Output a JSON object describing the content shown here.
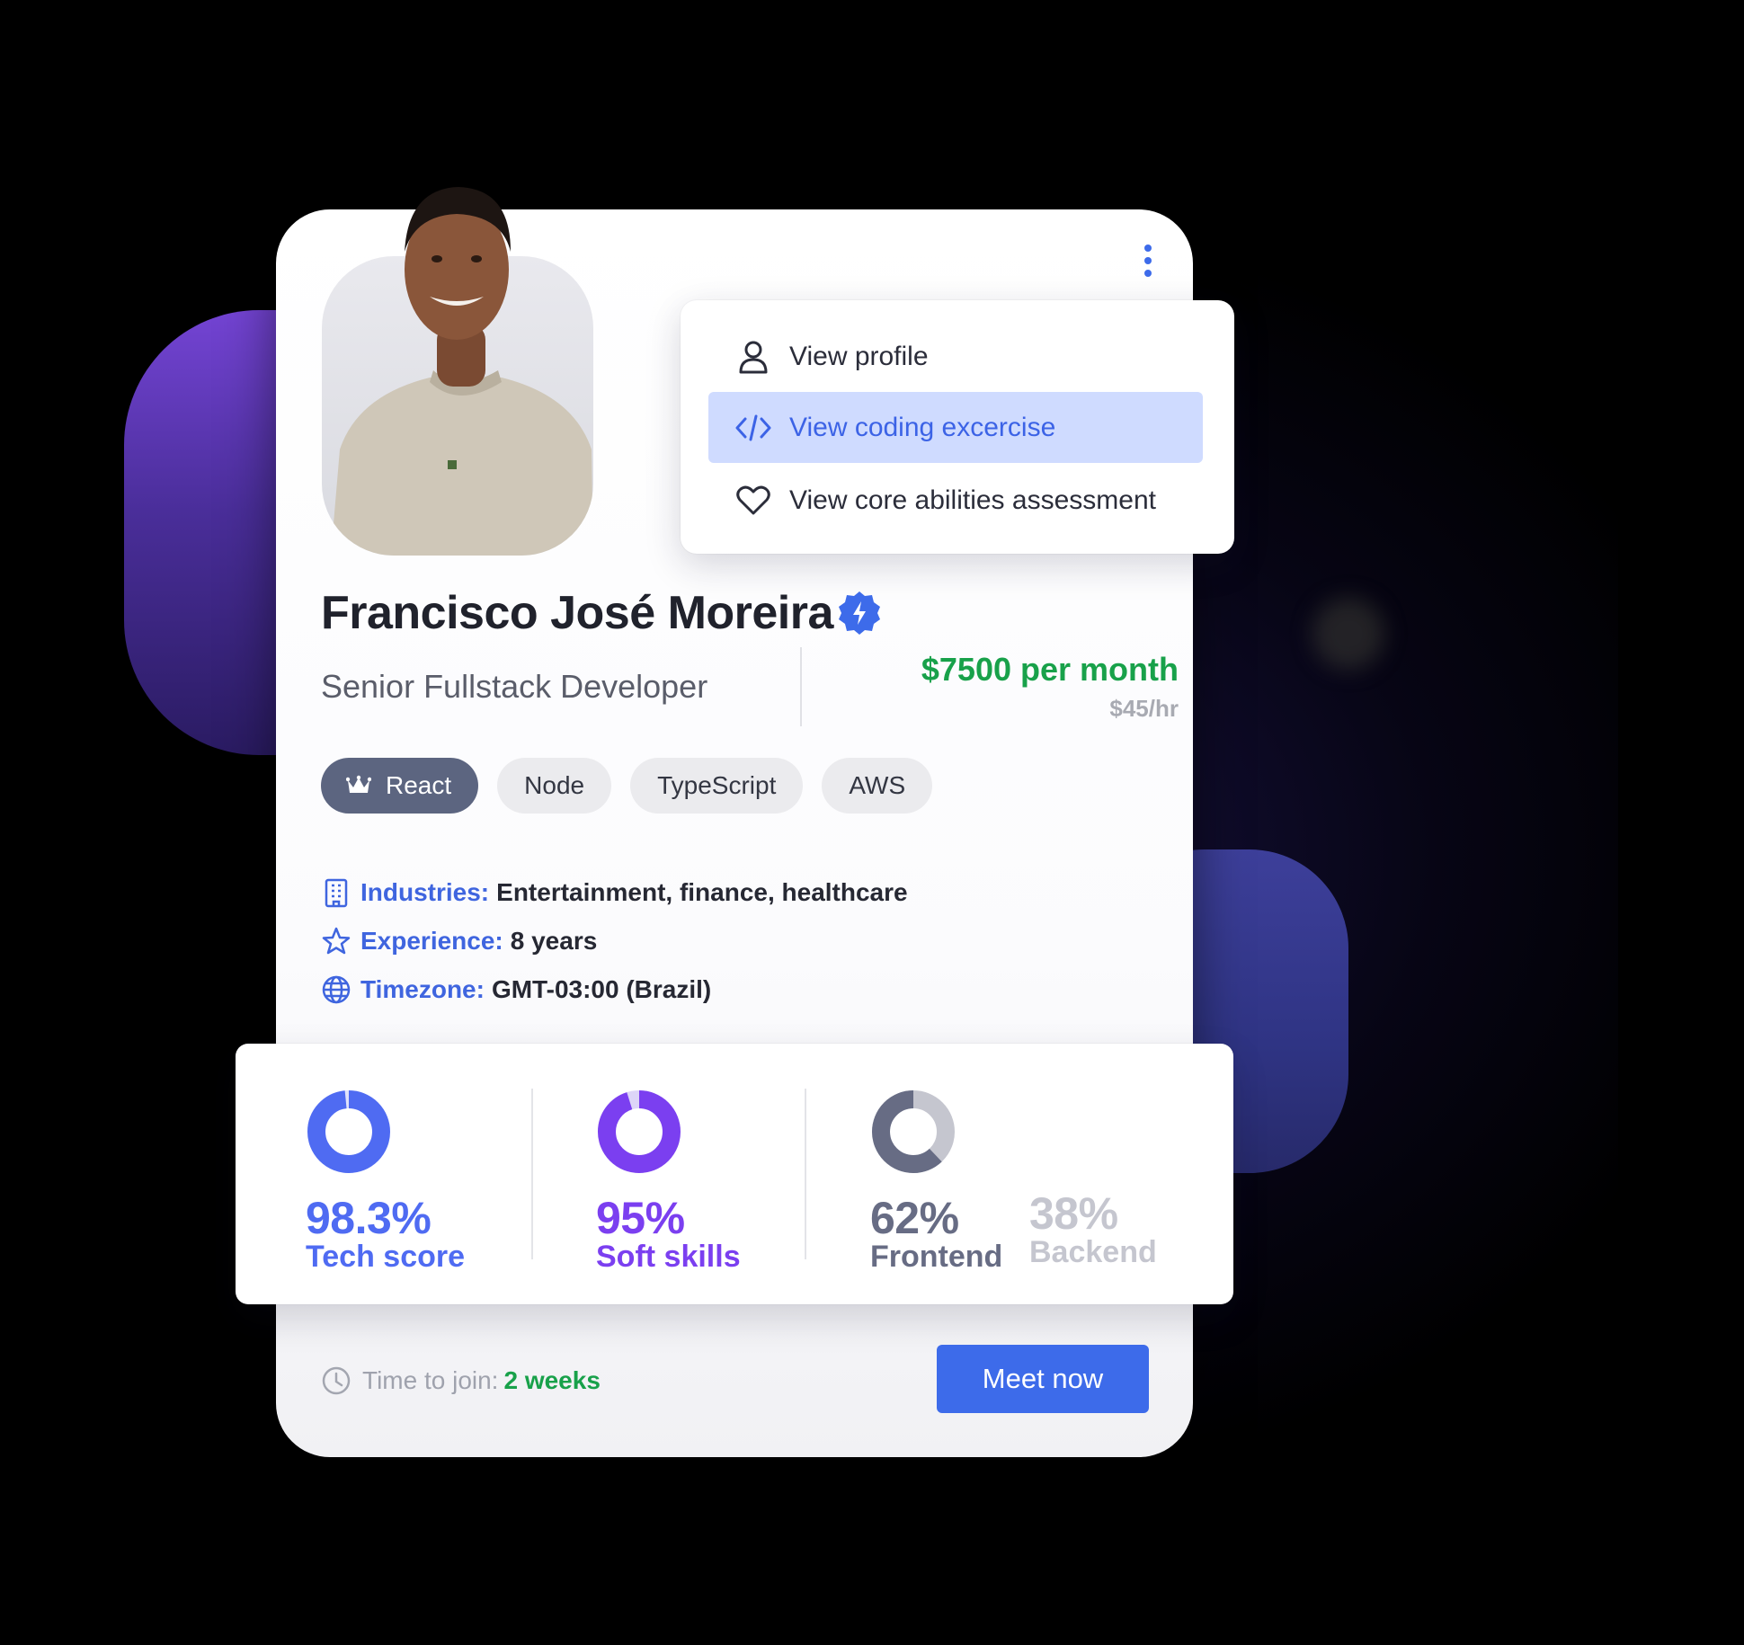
{
  "menu": {
    "items": [
      {
        "label": "View profile",
        "icon": "user-icon"
      },
      {
        "label": "View coding excercise",
        "icon": "code-icon",
        "active": true
      },
      {
        "label": "View core abilities assessment",
        "icon": "heart-icon"
      }
    ]
  },
  "profile": {
    "name": "Francisco José Moreira",
    "role": "Senior Fullstack Developer",
    "rate_month": "$7500 per month",
    "rate_hour": "$45/hr",
    "verified_icon": "verified-badge-icon"
  },
  "skills": [
    "React",
    "Node",
    "TypeScript",
    "AWS"
  ],
  "details": {
    "industries_label": "Industries:",
    "industries_value": "Entertainment, finance, healthcare",
    "experience_label": "Experience:",
    "experience_value": "8 years",
    "timezone_label": "Timezone:",
    "timezone_value": "GMT-03:00 (Brazil)"
  },
  "stats": {
    "tech": {
      "value": "98.3%",
      "label": "Tech score",
      "fraction": 0.983,
      "color": "#4f6bf2"
    },
    "soft": {
      "value": "95%",
      "label": "Soft skills",
      "fraction": 0.95,
      "color": "#7b3ff0"
    },
    "frontend": {
      "value": "62%",
      "label": "Frontend",
      "fraction": 0.62,
      "color": "#676c84"
    },
    "backend": {
      "value": "38%",
      "label": "Backend",
      "fraction": 0.38,
      "color": "#c5c6cf"
    }
  },
  "footer": {
    "join_label": "Time to join:",
    "join_value": "2 weeks",
    "meet_button": "Meet now"
  },
  "colors": {
    "accent": "#3d6bea",
    "price_green": "#18a14a",
    "menu_active_bg": "#cfdbff"
  }
}
